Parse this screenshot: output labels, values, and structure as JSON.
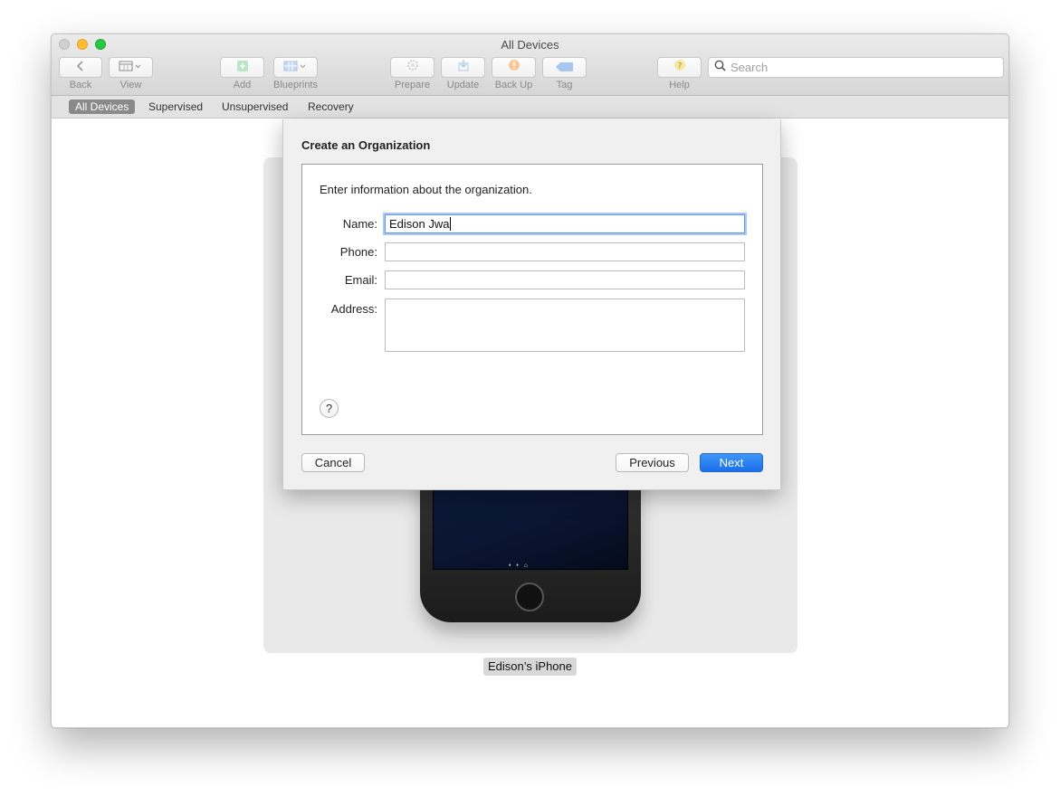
{
  "window": {
    "title": "All Devices"
  },
  "toolbar": {
    "back": "Back",
    "view": "View",
    "add": "Add",
    "blueprints": "Blueprints",
    "prepare": "Prepare",
    "update": "Update",
    "backup": "Back Up",
    "tag": "Tag",
    "help": "Help",
    "search_placeholder": "Search"
  },
  "filters": [
    "All Devices",
    "Supervised",
    "Unsupervised",
    "Recovery"
  ],
  "device": {
    "name": "Edison’s iPhone"
  },
  "sheet": {
    "title": "Create an Organization",
    "intro": "Enter information about the organization.",
    "labels": {
      "name": "Name:",
      "phone": "Phone:",
      "email": "Email:",
      "address": "Address:"
    },
    "values": {
      "name": "Edison Jwa",
      "phone": "",
      "email": "",
      "address": ""
    },
    "help": "?",
    "buttons": {
      "cancel": "Cancel",
      "previous": "Previous",
      "next": "Next"
    }
  },
  "colors": {
    "accent": "#1a6fe8",
    "focus_ring": "#a9c9f3",
    "filter_active": "#8a8a8a"
  },
  "icons": [
    "chevron-left-icon",
    "calendar-grid-icon",
    "add-icon",
    "blueprint-grid-icon",
    "gear-icon",
    "update-icon",
    "backup-icon",
    "tag-icon",
    "help-icon",
    "search-icon"
  ]
}
